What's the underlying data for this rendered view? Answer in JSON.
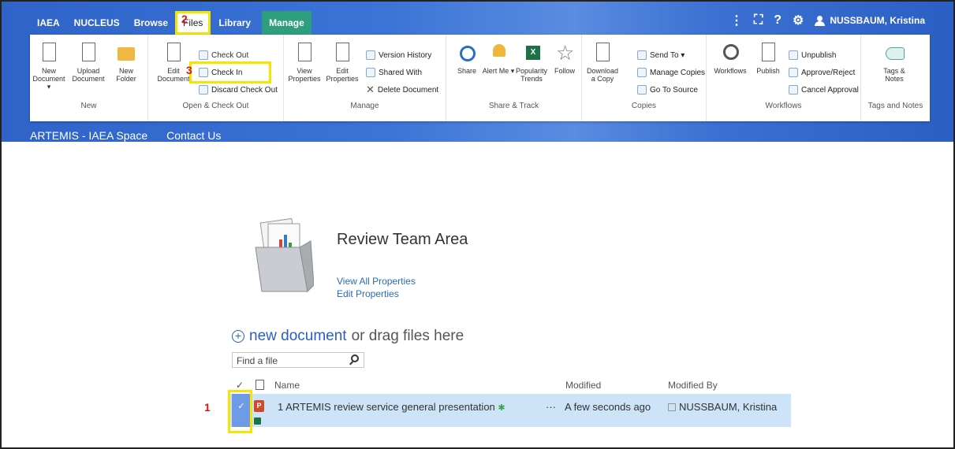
{
  "topnav": {
    "items": [
      "IAEA",
      "NUCLEUS",
      "Browse",
      "Files",
      "Library",
      "Manage"
    ],
    "user_name": "NUSSBAUM, Kristina",
    "marker_files": "2"
  },
  "ribbon": {
    "new": {
      "new_document": "New Document ▾",
      "upload_document": "Upload Document",
      "new_folder": "New Folder",
      "group": "New"
    },
    "checkout": {
      "edit_document": "Edit Document",
      "check_out": "Check Out",
      "check_in": "Check In",
      "discard": "Discard Check Out",
      "group": "Open & Check Out",
      "marker": "3"
    },
    "manage": {
      "view_properties": "View Properties",
      "edit_properties": "Edit Properties",
      "version_history": "Version History",
      "shared_with": "Shared With",
      "delete_document": "Delete Document",
      "group": "Manage"
    },
    "share": {
      "share": "Share",
      "alert_me": "Alert Me ▾",
      "popularity": "Popularity Trends",
      "follow": "Follow",
      "group": "Share & Track"
    },
    "copies": {
      "download": "Download a Copy",
      "send_to": "Send To ▾",
      "manage_copies": "Manage Copies",
      "go_to_source": "Go To Source",
      "group": "Copies"
    },
    "workflows": {
      "workflows": "Workflows",
      "publish": "Publish",
      "unpublish": "Unpublish",
      "approve": "Approve/Reject",
      "cancel_approval": "Cancel Approval",
      "group": "Workflows"
    },
    "tags": {
      "tags_notes": "Tags & Notes",
      "group": "Tags and Notes"
    }
  },
  "subnav": [
    "ARTEMIS - IAEA Space",
    "Contact Us"
  ],
  "library": {
    "title": "Review Team Area",
    "view_all": "View All Properties",
    "edit": "Edit Properties",
    "new_document": "new document",
    "drag_text": "or drag files here",
    "search_placeholder": "Find a file"
  },
  "table": {
    "headers": {
      "check": "✓",
      "name": "Name",
      "modified": "Modified",
      "modified_by": "Modified By"
    },
    "row": {
      "name": "1 ARTEMIS review service general presentation",
      "new_marker": "✱",
      "more": "···",
      "modified": "A few seconds ago",
      "modified_by": "NUSSBAUM, Kristina",
      "marker": "1"
    }
  }
}
